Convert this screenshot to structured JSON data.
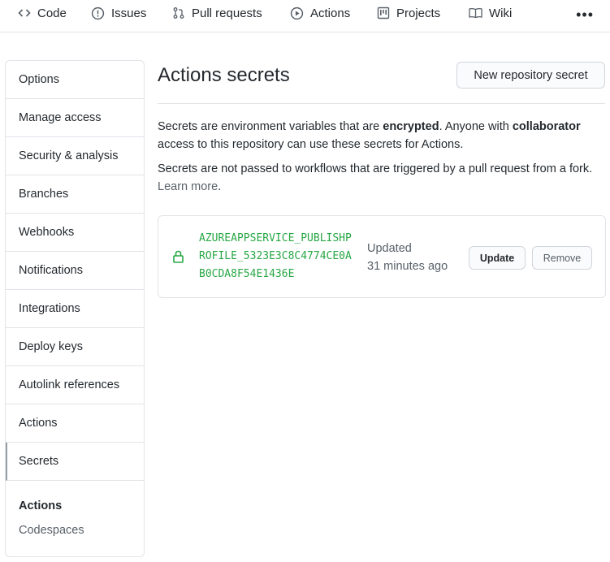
{
  "nav": {
    "tabs": [
      {
        "label": "Code",
        "icon": "code-icon"
      },
      {
        "label": "Issues",
        "icon": "issue-icon"
      },
      {
        "label": "Pull requests",
        "icon": "pull-request-icon"
      },
      {
        "label": "Actions",
        "icon": "play-icon"
      },
      {
        "label": "Projects",
        "icon": "project-icon"
      },
      {
        "label": "Wiki",
        "icon": "book-icon"
      }
    ],
    "more_label": "•••"
  },
  "sidebar": {
    "items": [
      {
        "label": "Options"
      },
      {
        "label": "Manage access"
      },
      {
        "label": "Security & analysis"
      },
      {
        "label": "Branches"
      },
      {
        "label": "Webhooks"
      },
      {
        "label": "Notifications"
      },
      {
        "label": "Integrations"
      },
      {
        "label": "Deploy keys"
      },
      {
        "label": "Autolink references"
      },
      {
        "label": "Actions"
      },
      {
        "label": "Secrets"
      }
    ],
    "selected": "Secrets",
    "section_heading": "Actions",
    "section_link": "Codespaces"
  },
  "main": {
    "title": "Actions secrets",
    "new_button": "New repository secret",
    "desc1_pre": "Secrets are environment variables that are ",
    "desc1_bold1": "encrypted",
    "desc1_mid": ". Anyone with ",
    "desc1_bold2": "collaborator",
    "desc1_post": " access to this repository can use these secrets for Actions.",
    "desc2_pre": "Secrets are not passed to workflows that are triggered by a pull request from a fork. ",
    "desc2_link": "Learn more",
    "desc2_post": ".",
    "secrets": [
      {
        "name": "AZUREAPPSERVICE_PUBLISHPROFILE_5323E3C8C4774CE0AB0CDA8F54E1436E",
        "updated_label": "Updated",
        "updated_time": "31 minutes ago",
        "update_button": "Update",
        "remove_button": "Remove"
      }
    ]
  },
  "colors": {
    "secret_name": "#28a745",
    "border": "#e1e4e8",
    "muted": "#586069"
  }
}
